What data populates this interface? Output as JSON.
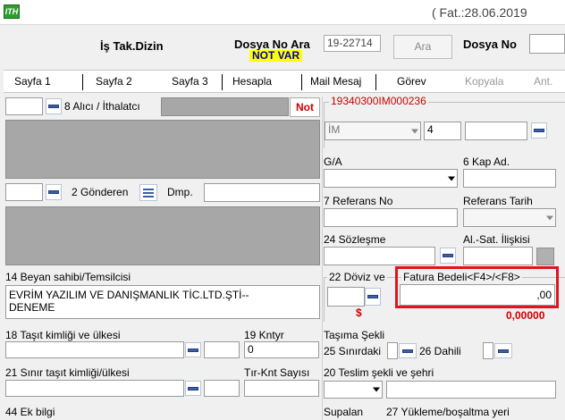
{
  "title_bar": {
    "fat_text": "( Fat.:28.06.2019"
  },
  "header": {
    "is_tak_dizin": "İş Tak.Dizin",
    "dosya_no_ara_label": "Dosya No Ara",
    "not_var": "NOT VAR",
    "dosya_no_ara_value": "19-22714",
    "ara_button": "Ara",
    "dosya_no_label": "Dosya No"
  },
  "tabs": {
    "sayfa1": "Sayfa 1",
    "sayfa2": "Sayfa 2",
    "sayfa3": "Sayfa 3",
    "hesapla": "Hesapla",
    "mail_mesaj": "Mail Mesaj",
    "gorev": "Görev",
    "kopyala": "Kopyala",
    "ant": "Ant."
  },
  "left": {
    "alici_label": "8 Alıcı / İthalatcı",
    "not_button": "Not",
    "gonderen_label": "2 Gönderen",
    "dmp_label": "Dmp.",
    "beyan_label": "14 Beyan sahibi/Temsilcisi",
    "beyan_value_line1": "EVRİM YAZILIM VE DANIŞMANLIK TİC.LTD.ŞTİ--",
    "beyan_value_line2": "DENEME",
    "tasit_label": "18 Taşıt kimliği ve ülkesi",
    "kntyr_label": "19 Kntyr",
    "kntyr_value": "0",
    "sinir_tasit_label": "21 Sınır taşıt kimliği/ülkesi",
    "tir_label": "Tır-Knt Sayısı",
    "ek_bilgi_label": "44 Ek bilgi"
  },
  "right": {
    "ref_code": "19340300IM000236",
    "rejim_select": "İM",
    "rejim_num": "4",
    "ga_label": "G/A",
    "kap_label": "6 Kap Ad.",
    "referans_no_label": "7 Referans No",
    "referans_tarih_label": "Referans Tarih",
    "sozlesme_label": "24 Sözleşme",
    "al_sat_label": "Al.-Sat. İlişkisi",
    "doviz_label": "22 Döviz ve",
    "fatura_label": "Fatura Bedeli<F4>/<F8>",
    "fatura_value": ",00",
    "dollar_sign": "$",
    "kur_value": "0,00000",
    "tasima_label": "Taşıma Şekli",
    "sinirdaki_label": "25 Sınırdaki",
    "dahili_label": "26 Dahili",
    "teslim_label": "20 Teslim şekli ve şehri",
    "supalan_label": "Supalan",
    "yukleme_label": "27 Yükleme/boşaltma yeri"
  },
  "colors": {
    "highlight_border": "#e0141e",
    "not_red": "#cc0000",
    "notvar_bg": "#ffff00",
    "section_red": "#cc0000"
  }
}
